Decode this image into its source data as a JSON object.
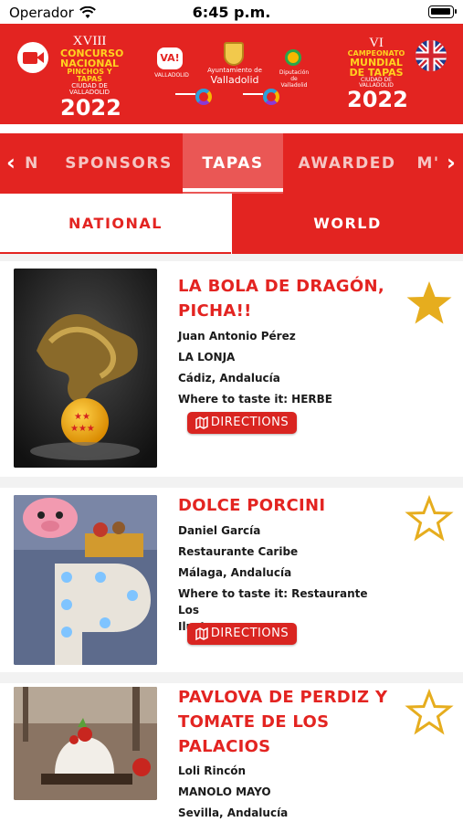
{
  "status_bar": {
    "carrier": "Operador",
    "time": "6:45 p.m."
  },
  "banner": {
    "left_logo": {
      "edition": "XVIII",
      "line1": "CONCURSO",
      "line2": "NACIONAL",
      "line3": "PINCHOS Y TAPAS",
      "line4": "CIUDAD DE VALLADOLID",
      "year": "2022"
    },
    "va_badge": "VA!",
    "va_caption": "VALLADOLID",
    "ayto_small": "Ayuntamiento de",
    "ayto_city": "Valladolid",
    "leaf_caption": "Diputación de Valladolid",
    "right_logo": {
      "edition": "VI",
      "line1": "CAMPEONATO",
      "line2": "MUNDIAL",
      "line3": "DE TAPAS",
      "line4": "CIUDAD DE VALLADOLID",
      "year": "2022"
    },
    "colors": {
      "red": "#e32421",
      "yellow": "#ffd21f"
    }
  },
  "tabs": {
    "left_partial": "N",
    "sponsors": "SPONSORS",
    "tapas": "TAPAS",
    "awarded": "AWARDED",
    "right_partial": "M'"
  },
  "subtabs": {
    "national": "NATIONAL",
    "world": "WORLD"
  },
  "cards": [
    {
      "title_line1": "LA BOLA DE DRAGÓN,",
      "title_line2": "PICHA!!",
      "chef": "Juan Antonio Pérez",
      "venue": "LA LONJA",
      "location": "Cádiz, Andalucía",
      "where": "Where to taste it: HERBE",
      "directions": "DIRECTIONS",
      "favorited": true
    },
    {
      "title_line1": "DOLCE PORCINI",
      "chef": "Daniel García",
      "venue": "Restaurante Caribe",
      "location": "Málaga, Andalucía",
      "where_line1": "Where to taste it: Restaurante Los",
      "where_line2": "Ilustres",
      "directions": "DIRECTIONS",
      "favorited": false
    },
    {
      "title_line1": "PAVLOVA DE PERDIZ Y",
      "title_line2": "TOMATE DE LOS",
      "title_line3": "PALACIOS",
      "chef": "Loli Rincón",
      "venue": "MANOLO MAYO",
      "location": "Sevilla, Andalucía",
      "favorited": false
    }
  ]
}
